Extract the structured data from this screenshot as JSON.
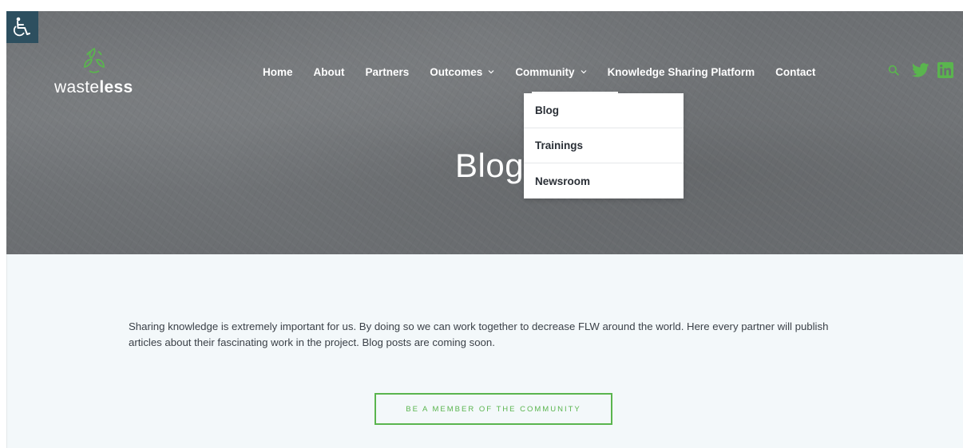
{
  "colors": {
    "accent": "#5ab54e",
    "a11y_bg": "#2d4f5f",
    "text_dark": "#2a2f36",
    "content_bg": "#f3f8fa"
  },
  "accessibility": {
    "icon": "wheelchair-icon"
  },
  "logo": {
    "text_light": "waste",
    "text_bold": "less",
    "icon": "recycle-leaf-icon"
  },
  "nav": {
    "items": [
      {
        "label": "Home"
      },
      {
        "label": "About"
      },
      {
        "label": "Partners"
      },
      {
        "label": "Outcomes",
        "has_dropdown": true
      },
      {
        "label": "Community",
        "has_dropdown": true,
        "open": true
      },
      {
        "label": "Knowledge Sharing Platform"
      },
      {
        "label": "Contact"
      }
    ],
    "icons": [
      "search-icon",
      "twitter-icon",
      "linkedin-icon"
    ]
  },
  "dropdown": {
    "items": [
      {
        "label": "Blog"
      },
      {
        "label": "Trainings"
      },
      {
        "label": "Newsroom"
      }
    ]
  },
  "hero": {
    "title": "Blog"
  },
  "content": {
    "intro": "Sharing knowledge is extremely important for us. By doing so we can work together to decrease FLW around the world. Here every partner will publish articles about their fascinating work in the project. Blog posts are coming soon.",
    "cta_label": "BE A MEMBER OF THE COMMUNITY"
  }
}
